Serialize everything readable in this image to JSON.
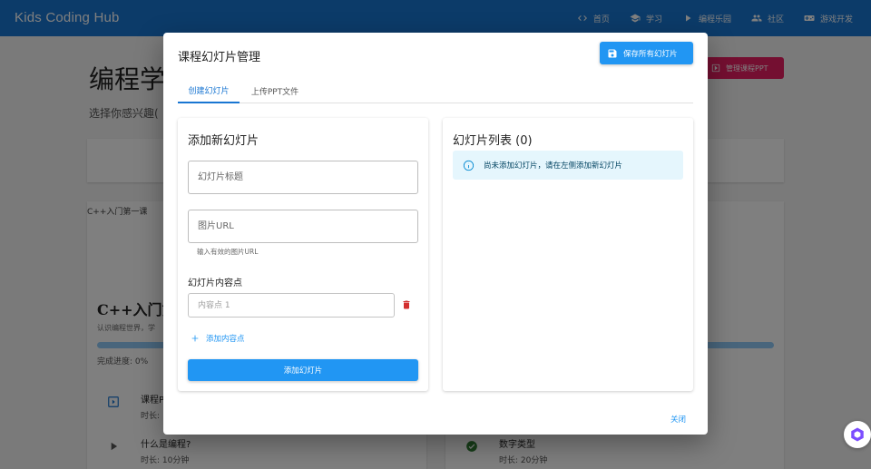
{
  "app": {
    "brand": "Kids Coding Hub"
  },
  "nav": [
    {
      "label": "首页",
      "icon": "code-icon"
    },
    {
      "label": "学习",
      "icon": "school-icon"
    },
    {
      "label": "编程乐园",
      "icon": "play-icon"
    },
    {
      "label": "社区",
      "icon": "people-icon"
    },
    {
      "label": "游戏开发",
      "icon": "gamepad-icon"
    }
  ],
  "background": {
    "page_title": "编程学",
    "page_subtitle": "选择你感兴趣(",
    "manage_ppt_label": "管理课程PPT",
    "broken_image_alt": "C++入门第一课",
    "course_title": "C++入门第",
    "course_desc": "认识编程世界，学",
    "progress_label": "完成进度: 0%",
    "progress": 0,
    "lessons": [
      {
        "title": "课程P",
        "duration": "时长:"
      },
      {
        "title": "什么是编程?",
        "duration": "时长: 10分钟"
      },
      {
        "title": "数字类型",
        "duration": "时长: 20分钟"
      }
    ]
  },
  "dialog": {
    "title": "课程幻灯片管理",
    "save_all_label": "保存所有幻灯片",
    "tabs": [
      {
        "label": "创建幻灯片",
        "active": true
      },
      {
        "label": "上传PPT文件",
        "active": false
      }
    ],
    "form": {
      "heading": "添加新幻灯片",
      "title_placeholder": "幻灯片标题",
      "image_url_placeholder": "图片URL",
      "image_url_helper": "输入有效的图片URL",
      "points_label": "幻灯片内容点",
      "point_placeholder": "内容点 1",
      "add_point_label": "添加内容点",
      "add_slide_label": "添加幻灯片"
    },
    "list": {
      "heading": "幻灯片列表 (0)",
      "empty_message": "尚未添加幻灯片，请在左侧添加新幻灯片"
    },
    "close_label": "关闭"
  },
  "colors": {
    "primary": "#2196f3",
    "appbar": "#1976d2",
    "danger": "#d32f2f",
    "accent_pink": "#e91e63",
    "info_bg": "#e5f6fd"
  }
}
